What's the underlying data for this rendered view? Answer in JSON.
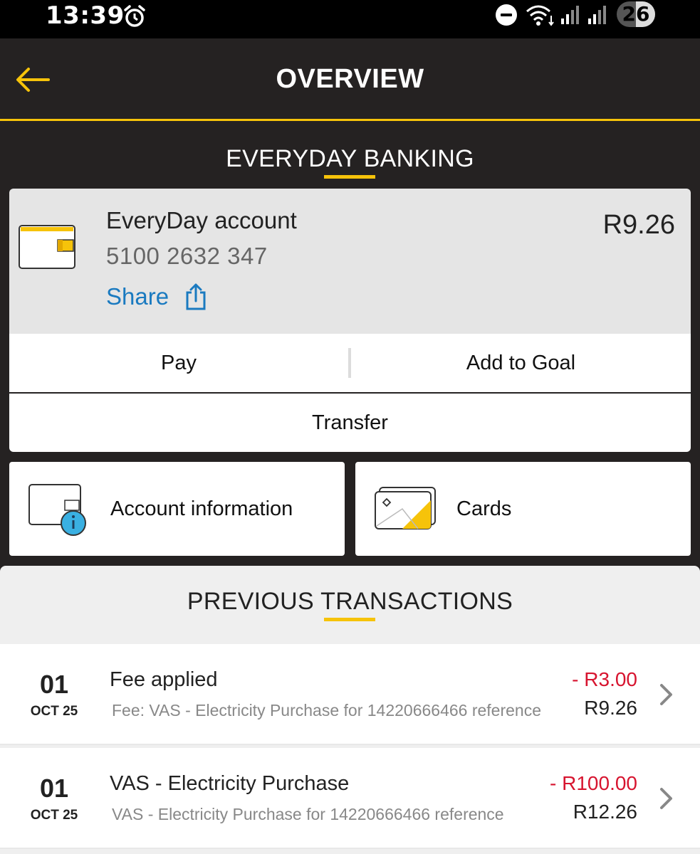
{
  "status_bar": {
    "time": "13:39",
    "battery": "26",
    "icons": [
      "alarm-icon",
      "do-not-disturb-icon",
      "wifi-icon",
      "signal-icon",
      "signal-icon",
      "battery-icon"
    ]
  },
  "header": {
    "title": "OVERVIEW",
    "back_icon": "arrow-left-icon"
  },
  "everyday_section": {
    "title": "EVERYDAY BANKING"
  },
  "account": {
    "icon": "wallet-icon",
    "name": "EveryDay account",
    "number": "5100 2632 347",
    "share_label": "Share",
    "share_icon": "share-icon",
    "balance": "R9.26"
  },
  "actions": {
    "pay": "Pay",
    "add_to_goal": "Add to Goal",
    "transfer": "Transfer"
  },
  "tiles": {
    "account_information": "Account information",
    "cards": "Cards"
  },
  "transactions_section": {
    "title": "PREVIOUS TRANSACTIONS"
  },
  "transactions": [
    {
      "day": "01",
      "month": "OCT 25",
      "title": "Fee applied",
      "description": "Fee: VAS - Electricity Purchase for 14220666466 reference",
      "amount": "- R3.00",
      "balance": "R9.26"
    },
    {
      "day": "01",
      "month": "OCT 25",
      "title": "VAS - Electricity Purchase",
      "description": "VAS - Electricity Purchase for 14220666466 reference",
      "amount": "- R100.00",
      "balance": "R12.26"
    }
  ],
  "colors": {
    "background": "#252222",
    "accent": "#f6c30a",
    "link": "#1a7ac0",
    "debit": "#d7142f",
    "info_badge": "#3ab0e2"
  }
}
